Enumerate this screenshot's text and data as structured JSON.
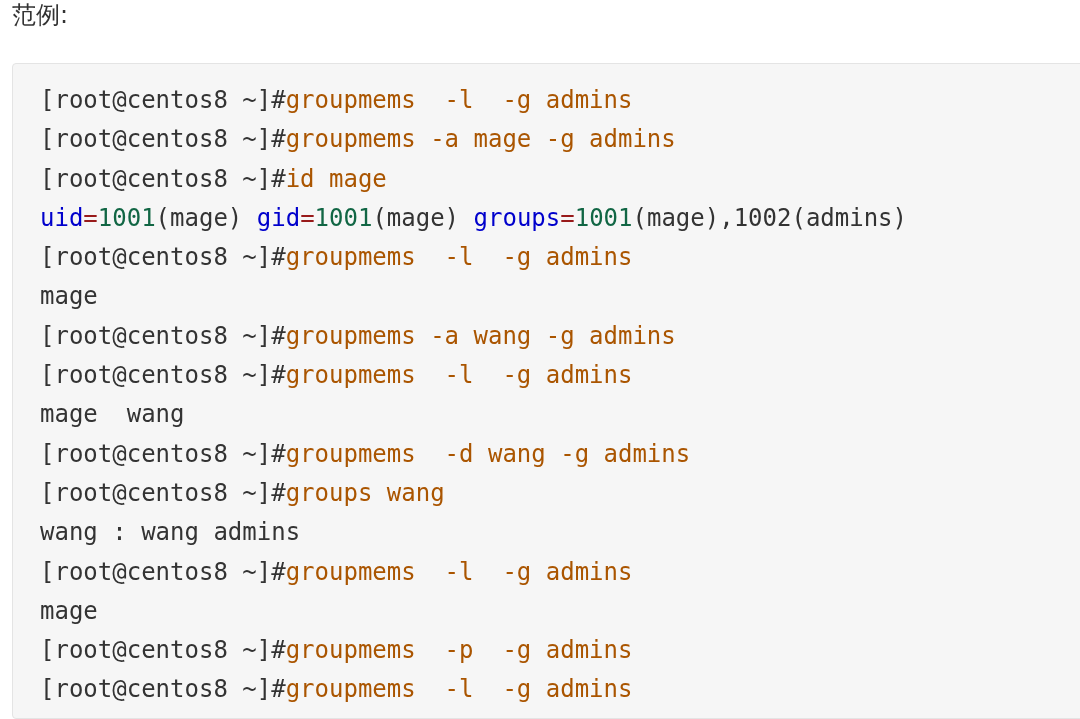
{
  "heading": "范例:",
  "code_lines": [
    {
      "segments": [
        {
          "kind": "prompt",
          "text": "[root@centos8 ~]#"
        },
        {
          "kind": "command",
          "text": "groupmems  -l  -g admins"
        }
      ]
    },
    {
      "segments": [
        {
          "kind": "prompt",
          "text": "[root@centos8 ~]#"
        },
        {
          "kind": "command",
          "text": "groupmems -a mage -g admins"
        }
      ]
    },
    {
      "segments": [
        {
          "kind": "prompt",
          "text": "[root@centos8 ~]#"
        },
        {
          "kind": "command",
          "text": "id mage"
        }
      ]
    },
    {
      "segments": [
        {
          "kind": "attr",
          "text": "uid"
        },
        {
          "kind": "op",
          "text": "="
        },
        {
          "kind": "number",
          "text": "1001"
        },
        {
          "kind": "output",
          "text": "(mage) "
        },
        {
          "kind": "attr",
          "text": "gid"
        },
        {
          "kind": "op",
          "text": "="
        },
        {
          "kind": "number",
          "text": "1001"
        },
        {
          "kind": "output",
          "text": "(mage) "
        },
        {
          "kind": "attr",
          "text": "groups"
        },
        {
          "kind": "op",
          "text": "="
        },
        {
          "kind": "number",
          "text": "1001"
        },
        {
          "kind": "output",
          "text": "(mage),1002(admins)"
        }
      ]
    },
    {
      "segments": [
        {
          "kind": "prompt",
          "text": "[root@centos8 ~]#"
        },
        {
          "kind": "command",
          "text": "groupmems  -l  -g admins"
        }
      ]
    },
    {
      "segments": [
        {
          "kind": "output",
          "text": "mage"
        }
      ]
    },
    {
      "segments": [
        {
          "kind": "prompt",
          "text": "[root@centos8 ~]#"
        },
        {
          "kind": "command",
          "text": "groupmems -a wang -g admins"
        }
      ]
    },
    {
      "segments": [
        {
          "kind": "prompt",
          "text": "[root@centos8 ~]#"
        },
        {
          "kind": "command",
          "text": "groupmems  -l  -g admins"
        }
      ]
    },
    {
      "segments": [
        {
          "kind": "output",
          "text": "mage  wang"
        }
      ]
    },
    {
      "segments": [
        {
          "kind": "prompt",
          "text": "[root@centos8 ~]#"
        },
        {
          "kind": "command",
          "text": "groupmems  -d wang -g admins"
        }
      ]
    },
    {
      "segments": [
        {
          "kind": "prompt",
          "text": "[root@centos8 ~]#"
        },
        {
          "kind": "command",
          "text": "groups wang"
        }
      ]
    },
    {
      "segments": [
        {
          "kind": "output",
          "text": "wang : wang admins"
        }
      ]
    },
    {
      "segments": [
        {
          "kind": "prompt",
          "text": "[root@centos8 ~]#"
        },
        {
          "kind": "command",
          "text": "groupmems  -l  -g admins"
        }
      ]
    },
    {
      "segments": [
        {
          "kind": "output",
          "text": "mage"
        }
      ]
    },
    {
      "segments": [
        {
          "kind": "prompt",
          "text": "[root@centos8 ~]#"
        },
        {
          "kind": "command",
          "text": "groupmems  -p  -g admins"
        }
      ]
    },
    {
      "segments": [
        {
          "kind": "prompt",
          "text": "[root@centos8 ~]#"
        },
        {
          "kind": "command",
          "text": "groupmems  -l  -g admins"
        }
      ]
    }
  ]
}
